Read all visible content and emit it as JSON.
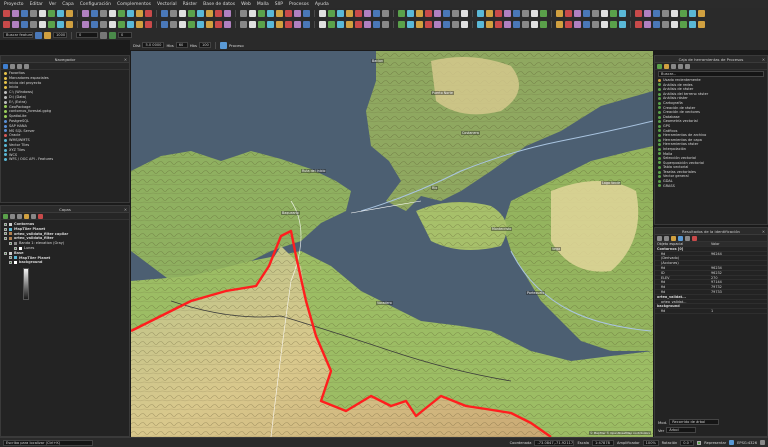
{
  "menubar": [
    "Proyecto",
    "Editar",
    "Ver",
    "Capa",
    "Configuración",
    "Complementos",
    "Vectorial",
    "Ráster",
    "Base de datos",
    "Web",
    "Malla",
    "SIIP",
    "Procesos",
    "Ayuda"
  ],
  "toolbar3": {
    "search_placeholder": "Buscar feature",
    "zoom": "1000",
    "field_a": "0",
    "field_b": "0"
  },
  "toolbar4": {
    "dist_label": "Dist",
    "dist_value": "5.0 0000",
    "hillshade_label": "Hbs",
    "hillshade_value": "60",
    "h_label": "Hbs",
    "h_value": "100",
    "proceso": "Proceso"
  },
  "browser": {
    "title": "Navegador",
    "items": [
      {
        "label": "Favoritos",
        "color": "#e6c24a"
      },
      {
        "label": "Marcadores espaciales",
        "color": "#e6c24a"
      },
      {
        "label": "Inicio del proyecto",
        "color": "#e6c24a"
      },
      {
        "label": "Inicio",
        "color": "#e6c24a"
      },
      {
        "label": "C:\\ (Windows)",
        "color": "#bdbdbd"
      },
      {
        "label": "D:\\ (Data)",
        "color": "#bdbdbd"
      },
      {
        "label": "E:\\ (Extra)",
        "color": "#bdbdbd"
      },
      {
        "label": "GeoPackage",
        "color": "#9acd5a"
      },
      {
        "label": "contornos_forestal.gpkg",
        "color": "#9acd5a"
      },
      {
        "label": "SpatiaLite",
        "color": "#9acd5a"
      },
      {
        "label": "PostgreSQL",
        "color": "#5a8fd6"
      },
      {
        "label": "SAP HANA",
        "color": "#5a8fd6"
      },
      {
        "label": "MS SQL Server",
        "color": "#5a8fd6"
      },
      {
        "label": "Oracle",
        "color": "#d65a5a"
      },
      {
        "label": "WMS/WMTS",
        "color": "#5ab8d6"
      },
      {
        "label": "Vector Tiles",
        "color": "#5ab8d6"
      },
      {
        "label": "XYZ Tiles",
        "color": "#5ab8d6"
      },
      {
        "label": "WCS",
        "color": "#5ab8d6"
      },
      {
        "label": "WFS / OGC API - Features",
        "color": "#5ab8d6"
      }
    ]
  },
  "layers": {
    "title": "Capas",
    "items": [
      {
        "label": "Contornos",
        "indent": 0,
        "color": "#cfcfcf",
        "bold": true
      },
      {
        "label": "MapTiler Planet",
        "indent": 0,
        "color": "#5ab8d6",
        "bold": true
      },
      {
        "label": "orteo_validata_filter capilar",
        "indent": 0,
        "color": "#b08050",
        "bold": true
      },
      {
        "label": "orteo_validata_filter",
        "indent": 0,
        "color": "#b08050",
        "bold": true
      },
      {
        "label": "Banda 1: elevation (Gray)",
        "indent": 1,
        "color": "#888888",
        "bold": false
      },
      {
        "label": "Lunes",
        "indent": 2,
        "color": "#ffffff",
        "bold": false
      },
      {
        "label": "Base",
        "indent": 0,
        "color": "#cfcfcf",
        "bold": true
      },
      {
        "label": "MapTiler Planet",
        "indent": 1,
        "color": "#5ab8d6",
        "bold": true
      },
      {
        "label": "background",
        "indent": 1,
        "color": "#ffffff",
        "bold": true
      }
    ]
  },
  "toolbox": {
    "title": "Caja de herramientas de Procesos",
    "search_placeholder": "Buscar...",
    "items": [
      "Usado recientemente",
      "Análisis de redes",
      "Análisis de ráster",
      "Análisis del terreno ráster",
      "Análisis ráster",
      "Cartografía",
      "Creación de ráster",
      "Creación de vectores",
      "Database",
      "Geometría vectorial",
      "GPS",
      "Gráficos",
      "Herramientas de archivo",
      "Herramientas de capa",
      "Herramientas ráster",
      "Interpolación",
      "Malla",
      "Selección vectorial",
      "Superposición vectorial",
      "Tabla vectorial",
      "Teselas vectoriales",
      "Vector general",
      "GDAL",
      "GRASS"
    ]
  },
  "identify": {
    "title": "Resultados de la identificación",
    "col_feature": "Objeto espacial",
    "col_value": "Valor",
    "rows": [
      {
        "k": "Contornos [0]",
        "v": "",
        "bold": true
      },
      {
        "k": "fid",
        "v": "96244"
      },
      {
        "k": "(Derivado)",
        "v": ""
      },
      {
        "k": "(Acciones)",
        "v": ""
      },
      {
        "k": "fid",
        "v": "96234"
      },
      {
        "k": "ID",
        "v": "96232"
      },
      {
        "k": "ELEV",
        "v": "270"
      },
      {
        "k": "fid",
        "v": "97144"
      },
      {
        "k": "fid",
        "v": "79732"
      },
      {
        "k": "fid",
        "v": "79733"
      },
      {
        "k": "orteo_validat...",
        "v": "",
        "bold": true
      },
      {
        "k": "orteo_validat...",
        "v": ""
      },
      {
        "k": "background",
        "v": "",
        "bold": true
      },
      {
        "k": "fid",
        "v": "1"
      }
    ],
    "mode_label": "Mod.",
    "mode_value": "Recorrido de árbol",
    "view_label": "Ver",
    "view_value": "Árbol"
  },
  "status": {
    "search_placeholder": "Escriba para localizar (Ctrl+K)",
    "coord_label": "Coordenada",
    "coord_value": "-73.0847,-71.92117",
    "scale_label": "Escala",
    "scale_value": "1:47878",
    "mag_label": "Amplificador",
    "mag_value": "100%",
    "rot_label": "Rotación",
    "rot_value": "0.0 °",
    "render_label": "Representar",
    "crs": "EPSG:4326"
  },
  "map": {
    "labels": [
      "Baclon",
      "Ruta del Inicio",
      "Costanera",
      "Río",
      "Baqueano",
      "Montecristo",
      "Vega",
      "Lago Verde",
      "Varadero",
      "Puerto Norte",
      "Portezuelo"
    ],
    "attribution": "© MapTiler © OpenStreetMap contributors"
  }
}
